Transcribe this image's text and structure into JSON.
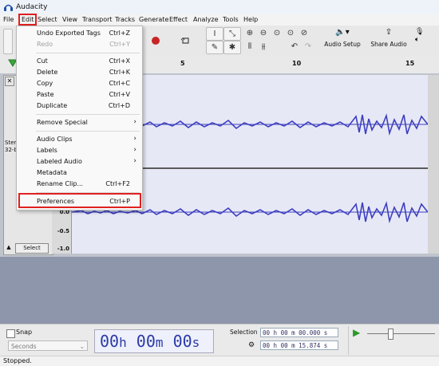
{
  "app": {
    "title": "Audacity"
  },
  "menubar": [
    "File",
    "Edit",
    "Select",
    "View",
    "Transport",
    "Tracks",
    "Generate",
    "Effect",
    "Analyze",
    "Tools",
    "Help"
  ],
  "toolbar": {
    "audio_setup_label": "Audio Setup",
    "share_audio_label": "Share Audio"
  },
  "ruler": {
    "ticks": [
      "5",
      "10",
      "15"
    ]
  },
  "track": {
    "info_line1": "Stere",
    "info_line2": "32-bi",
    "select_label": "Select",
    "scale": {
      "top_upper": "0.0",
      "bottom_mid": "0.0",
      "bottom_neg": "-0.5",
      "bottom_min": "-1.0"
    }
  },
  "edit_menu": {
    "items": [
      {
        "label": "Undo Exported Tags",
        "shortcut": "Ctrl+Z",
        "enabled": true
      },
      {
        "label": "Redo",
        "shortcut": "Ctrl+Y",
        "enabled": false
      },
      {
        "label": "Cut",
        "shortcut": "Ctrl+X",
        "enabled": true
      },
      {
        "label": "Delete",
        "shortcut": "Ctrl+K",
        "enabled": true
      },
      {
        "label": "Copy",
        "shortcut": "Ctrl+C",
        "enabled": true
      },
      {
        "label": "Paste",
        "shortcut": "Ctrl+V",
        "enabled": true
      },
      {
        "label": "Duplicate",
        "shortcut": "Ctrl+D",
        "enabled": true
      },
      {
        "label": "Remove Special",
        "shortcut": "",
        "enabled": true,
        "submenu": true
      },
      {
        "label": "Audio Clips",
        "shortcut": "",
        "enabled": true,
        "submenu": true
      },
      {
        "label": "Labels",
        "shortcut": "",
        "enabled": true,
        "submenu": true
      },
      {
        "label": "Labeled Audio",
        "shortcut": "",
        "enabled": true,
        "submenu": true
      },
      {
        "label": "Metadata",
        "shortcut": "",
        "enabled": true
      },
      {
        "label": "Rename Clip...",
        "shortcut": "Ctrl+F2",
        "enabled": true
      },
      {
        "label": "Preferences",
        "shortcut": "Ctrl+P",
        "enabled": true
      }
    ]
  },
  "bottom": {
    "snap_label": "Snap",
    "snap_unit": "Seconds",
    "time_hh": "00",
    "time_h": "h",
    "time_mm": "00",
    "time_m": "m",
    "time_ss": "00",
    "time_s": "s",
    "selection_label": "Selection",
    "sel_start": "00 h 00 m 00.000 s",
    "sel_end": "00 h 00 m 15.874 s"
  },
  "status": {
    "text": "Stopped."
  },
  "colors": {
    "accent_red": "#e02020",
    "waveform": "#3d3fbf",
    "empty_track_area": "#8e96ab"
  }
}
